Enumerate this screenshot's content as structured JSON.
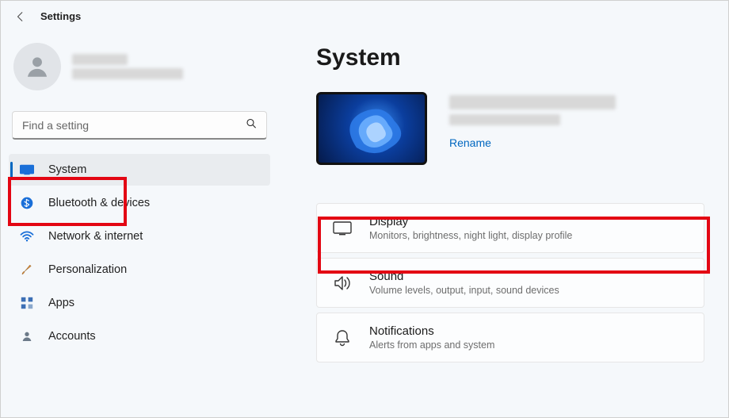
{
  "app": {
    "title": "Settings"
  },
  "search": {
    "placeholder": "Find a setting"
  },
  "nav": {
    "items": [
      {
        "label": "System"
      },
      {
        "label": "Bluetooth & devices"
      },
      {
        "label": "Network & internet"
      },
      {
        "label": "Personalization"
      },
      {
        "label": "Apps"
      },
      {
        "label": "Accounts"
      }
    ]
  },
  "page": {
    "title": "System",
    "rename": "Rename"
  },
  "cards": [
    {
      "title": "Display",
      "sub": "Monitors, brightness, night light, display profile"
    },
    {
      "title": "Sound",
      "sub": "Volume levels, output, input, sound devices"
    },
    {
      "title": "Notifications",
      "sub": "Alerts from apps and system"
    }
  ]
}
